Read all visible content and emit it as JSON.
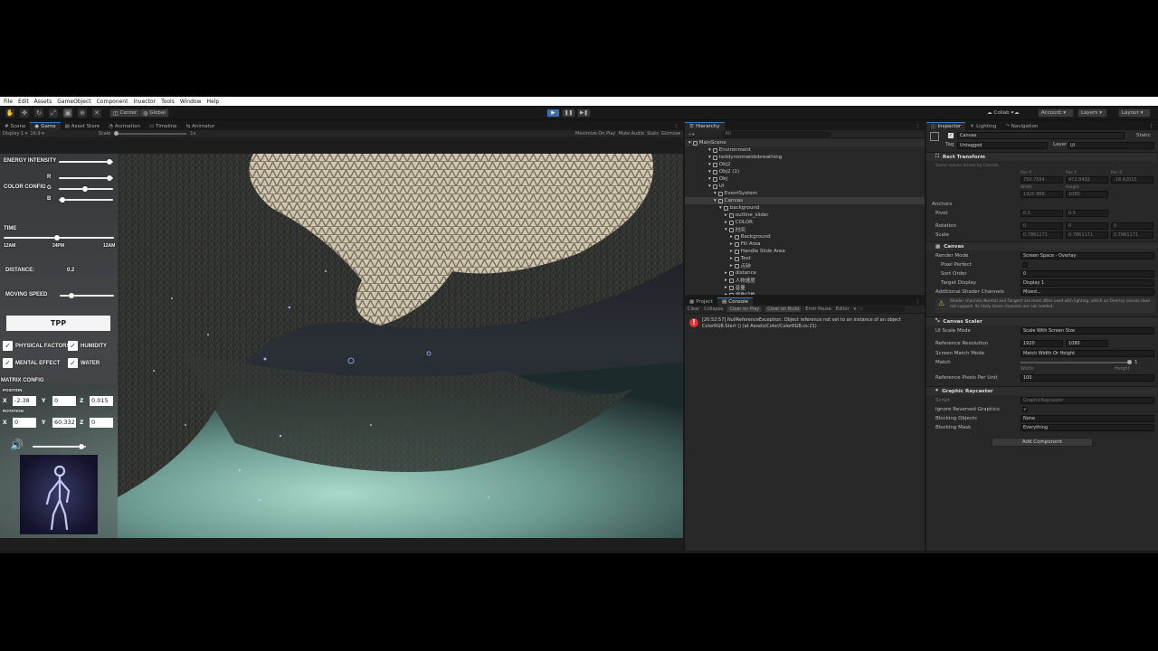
{
  "menu": [
    "File",
    "Edit",
    "Assets",
    "GameObject",
    "Component",
    "Invector",
    "Tools",
    "Window",
    "Help"
  ],
  "toolbar": {
    "pivot": "Center",
    "space": "Global",
    "collab": "Collab",
    "account": "Account",
    "layers": "Layers",
    "layout": "Layout"
  },
  "scene_tabs": [
    "Scene",
    "Game",
    "Asset Store",
    "Animation",
    "Timeline",
    "Animator"
  ],
  "game_bar": {
    "display": "Display 1",
    "aspect": "16:9",
    "scale_label": "Scale",
    "scale_value": "1x",
    "maximize": "Maximize On Play",
    "mute": "Mute Audio",
    "stats": "Stats",
    "gizmos": "Gizmos"
  },
  "game_ui": {
    "energy_intensity": "ENERGY INTENSITY",
    "color_config": "COLOR CONFIG",
    "r": "R",
    "g": "G",
    "b": "B",
    "time": "TIME",
    "time_ticks": [
      "12AM",
      "24PM",
      "12AM"
    ],
    "distance_label": "DISTANCE:",
    "distance_value": "0.2",
    "moving_speed": "MOVING SPEED",
    "tpp_button": "TPP",
    "physical_factors": "PHYSICAL FACTORS",
    "humidity": "HUMIDITY",
    "mental_effect": "MENTAL EFFECT",
    "water": "WATER",
    "matrix_config": "MATRIX CONFIG",
    "position": "POSITION",
    "rotation": "ROTATION",
    "pos_x": "-2.38",
    "pos_y": "0",
    "pos_z": "0.015",
    "rot_x": "0",
    "rot_y": "60.332",
    "rot_z": "0",
    "x": "X",
    "y": "Y",
    "z": "Z",
    "sliders": {
      "energy": 0.93,
      "r": 0.93,
      "g": 0.48,
      "b": 0.06,
      "time": 0.48,
      "speed": 0.22,
      "volume": 0.92
    }
  },
  "hierarchy": {
    "tab": "Hierarchy",
    "search_placeholder": "All",
    "items": [
      {
        "name": "MainScene",
        "depth": 0
      },
      {
        "name": "Environment",
        "depth": 1
      },
      {
        "name": "teddyroomwidebreathing",
        "depth": 1
      },
      {
        "name": "Obj2",
        "depth": 1
      },
      {
        "name": "Obj2 (1)",
        "depth": 1
      },
      {
        "name": "Obj",
        "depth": 1
      },
      {
        "name": "UI",
        "depth": 1
      },
      {
        "name": "EventSystem",
        "depth": 2
      },
      {
        "name": "Canvas",
        "depth": 2
      },
      {
        "name": "background",
        "depth": 3
      },
      {
        "name": "outline_slider",
        "depth": 4
      },
      {
        "name": "COLOR",
        "depth": 4
      },
      {
        "name": "时间",
        "depth": 4
      },
      {
        "name": "Background",
        "depth": 5
      },
      {
        "name": "Fill Area",
        "depth": 5
      },
      {
        "name": "Handle Slide Area",
        "depth": 5
      },
      {
        "name": "Text",
        "depth": 5
      },
      {
        "name": "点钟",
        "depth": 5
      },
      {
        "name": "distance",
        "depth": 4
      },
      {
        "name": "人物速度",
        "depth": 4
      },
      {
        "name": "音量",
        "depth": 4
      },
      {
        "name": "视角切换",
        "depth": 4
      }
    ]
  },
  "console": {
    "tabs": [
      "Project",
      "Console"
    ],
    "buttons": [
      "Clear",
      "Collapse",
      "Clear on Play",
      "Clear on Build",
      "Error Pause",
      "Editor"
    ],
    "error_line1": "[20:52:57] NullReferenceException: Object reference not set to an instance of an object",
    "error_line2": "ColorRGB.Start () (at Assets/Color/ColorRGB.cs:21)"
  },
  "inspector": {
    "tabs": [
      "Inspector",
      "Lighting",
      "Navigation"
    ],
    "object_name": "Canvas",
    "static": "Static",
    "tag_label": "Tag",
    "tag_value": "Untagged",
    "layer_label": "Layer",
    "layer_value": "UI",
    "rect_transform": "Rect Transform",
    "rect_note": "Some values driven by Canvas.",
    "pos_labels": [
      "Pos X",
      "Pos Y",
      "Pos Z"
    ],
    "pos_values": [
      "750.7554",
      "472.8402",
      "-18.42015"
    ],
    "size_labels": [
      "Width",
      "Height"
    ],
    "size_values": [
      "1920.868",
      "1080"
    ],
    "anchors": "Anchors",
    "pivot": "Pivot",
    "pivot_x": "0.5",
    "pivot_y": "0.5",
    "rotation": "Rotation",
    "rot_values": [
      "0",
      "0",
      "0"
    ],
    "scale": "Scale",
    "scale_values": [
      "0.7861171",
      "0.7861171",
      "0.7861171"
    ],
    "canvas": "Canvas",
    "render_mode": "Render Mode",
    "render_mode_value": "Screen Space - Overlay",
    "pixel_perfect": "Pixel Perfect",
    "sort_order": "Sort Order",
    "sort_order_value": "0",
    "target_display": "Target Display",
    "target_display_value": "Display 1",
    "shader_channels": "Additional Shader Channels",
    "shader_channels_value": "Mixed...",
    "shader_note": "Shader channels Normal and Tangent are most often used with lighting, which an Overlay canvas does not support. Its likely these channels are not needed.",
    "canvas_scaler": "Canvas Scaler",
    "ui_scale_mode": "UI Scale Mode",
    "ui_scale_mode_value": "Scale With Screen Size",
    "ref_res": "Reference Resolution",
    "ref_x": "1920",
    "ref_y": "1080",
    "match_mode": "Screen Match Mode",
    "match_mode_value": "Match Width Or Height",
    "match": "Match",
    "match_value": "1",
    "width": "Width",
    "height": "Height",
    "ref_ppu": "Reference Pixels Per Unit",
    "ref_ppu_value": "100",
    "graphic_raycaster": "Graphic Raycaster",
    "script": "Script",
    "script_value": "GraphicRaycaster",
    "ignore_reversed": "Ignore Reversed Graphics",
    "blocking_objects": "Blocking Objects",
    "blocking_objects_value": "None",
    "blocking_mask": "Blocking Mask",
    "blocking_mask_value": "Everything",
    "add_component": "Add Component"
  }
}
